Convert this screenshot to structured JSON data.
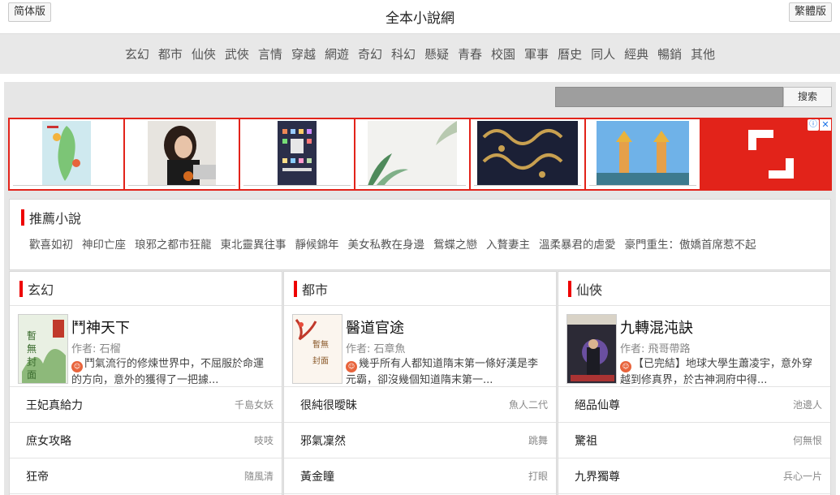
{
  "header": {
    "left_button": "简体版",
    "title": "全本小說網",
    "right_button": "繁體版"
  },
  "nav": [
    "玄幻",
    "都市",
    "仙俠",
    "武俠",
    "言情",
    "穿越",
    "網遊",
    "奇幻",
    "科幻",
    "懸疑",
    "青春",
    "校園",
    "軍事",
    "曆史",
    "同人",
    "經典",
    "暢銷",
    "其他"
  ],
  "search": {
    "button": "搜索",
    "placeholder": ""
  },
  "ad": {
    "info": "ⓘ",
    "close": "✕"
  },
  "recommend": {
    "title": "推薦小說",
    "items": [
      "歡喜如初",
      "神印亡座",
      "琅邪之都市狂龍",
      "東北靈異往事",
      "靜候錦年",
      "美女私教在身邊",
      "鴛蝶之戀",
      "入贅妻主",
      "溫柔暴君的虐愛",
      "豪門重生：傲嬌首席惹不起"
    ]
  },
  "categories": [
    {
      "title": "玄幻",
      "featured": {
        "title": "鬥神天下",
        "author": "作者: 石榴",
        "desc": "鬥氣流行的修煉世界中，不屈服於命運的方向，意外的獲得了一把據..."
      },
      "rows": [
        {
          "name": "王妃真給力",
          "author": "千島女妖"
        },
        {
          "name": "庶女攻略",
          "author": "吱吱"
        },
        {
          "name": "狂帝",
          "author": "隨風清"
        }
      ]
    },
    {
      "title": "都市",
      "featured": {
        "title": "醫道官途",
        "author": "作者: 石章魚",
        "desc": "幾乎所有人都知道隋末第一條好漢是李元霸，卻沒幾個知道隋末第一..."
      },
      "rows": [
        {
          "name": "很純很曖昧",
          "author": "魚人二代"
        },
        {
          "name": "邪氣凜然",
          "author": "跳舞"
        },
        {
          "name": "黃金瞳",
          "author": "打眼"
        }
      ]
    },
    {
      "title": "仙俠",
      "featured": {
        "title": "九轉混沌訣",
        "author": "作者: 飛哥帶路",
        "desc": "【已完結】地球大學生蕭凌宇，意外穿越到修真界，於古神洞府中得..."
      },
      "rows": [
        {
          "name": "絕品仙尊",
          "author": "池邊人"
        },
        {
          "name": "驚祖",
          "author": "何無恨"
        },
        {
          "name": "九界獨尊",
          "author": "兵心一片"
        }
      ]
    }
  ],
  "colors": {
    "accent": "#ee0000",
    "ad_bg": "#e2231a",
    "nav_bg": "#e8e8e8"
  }
}
